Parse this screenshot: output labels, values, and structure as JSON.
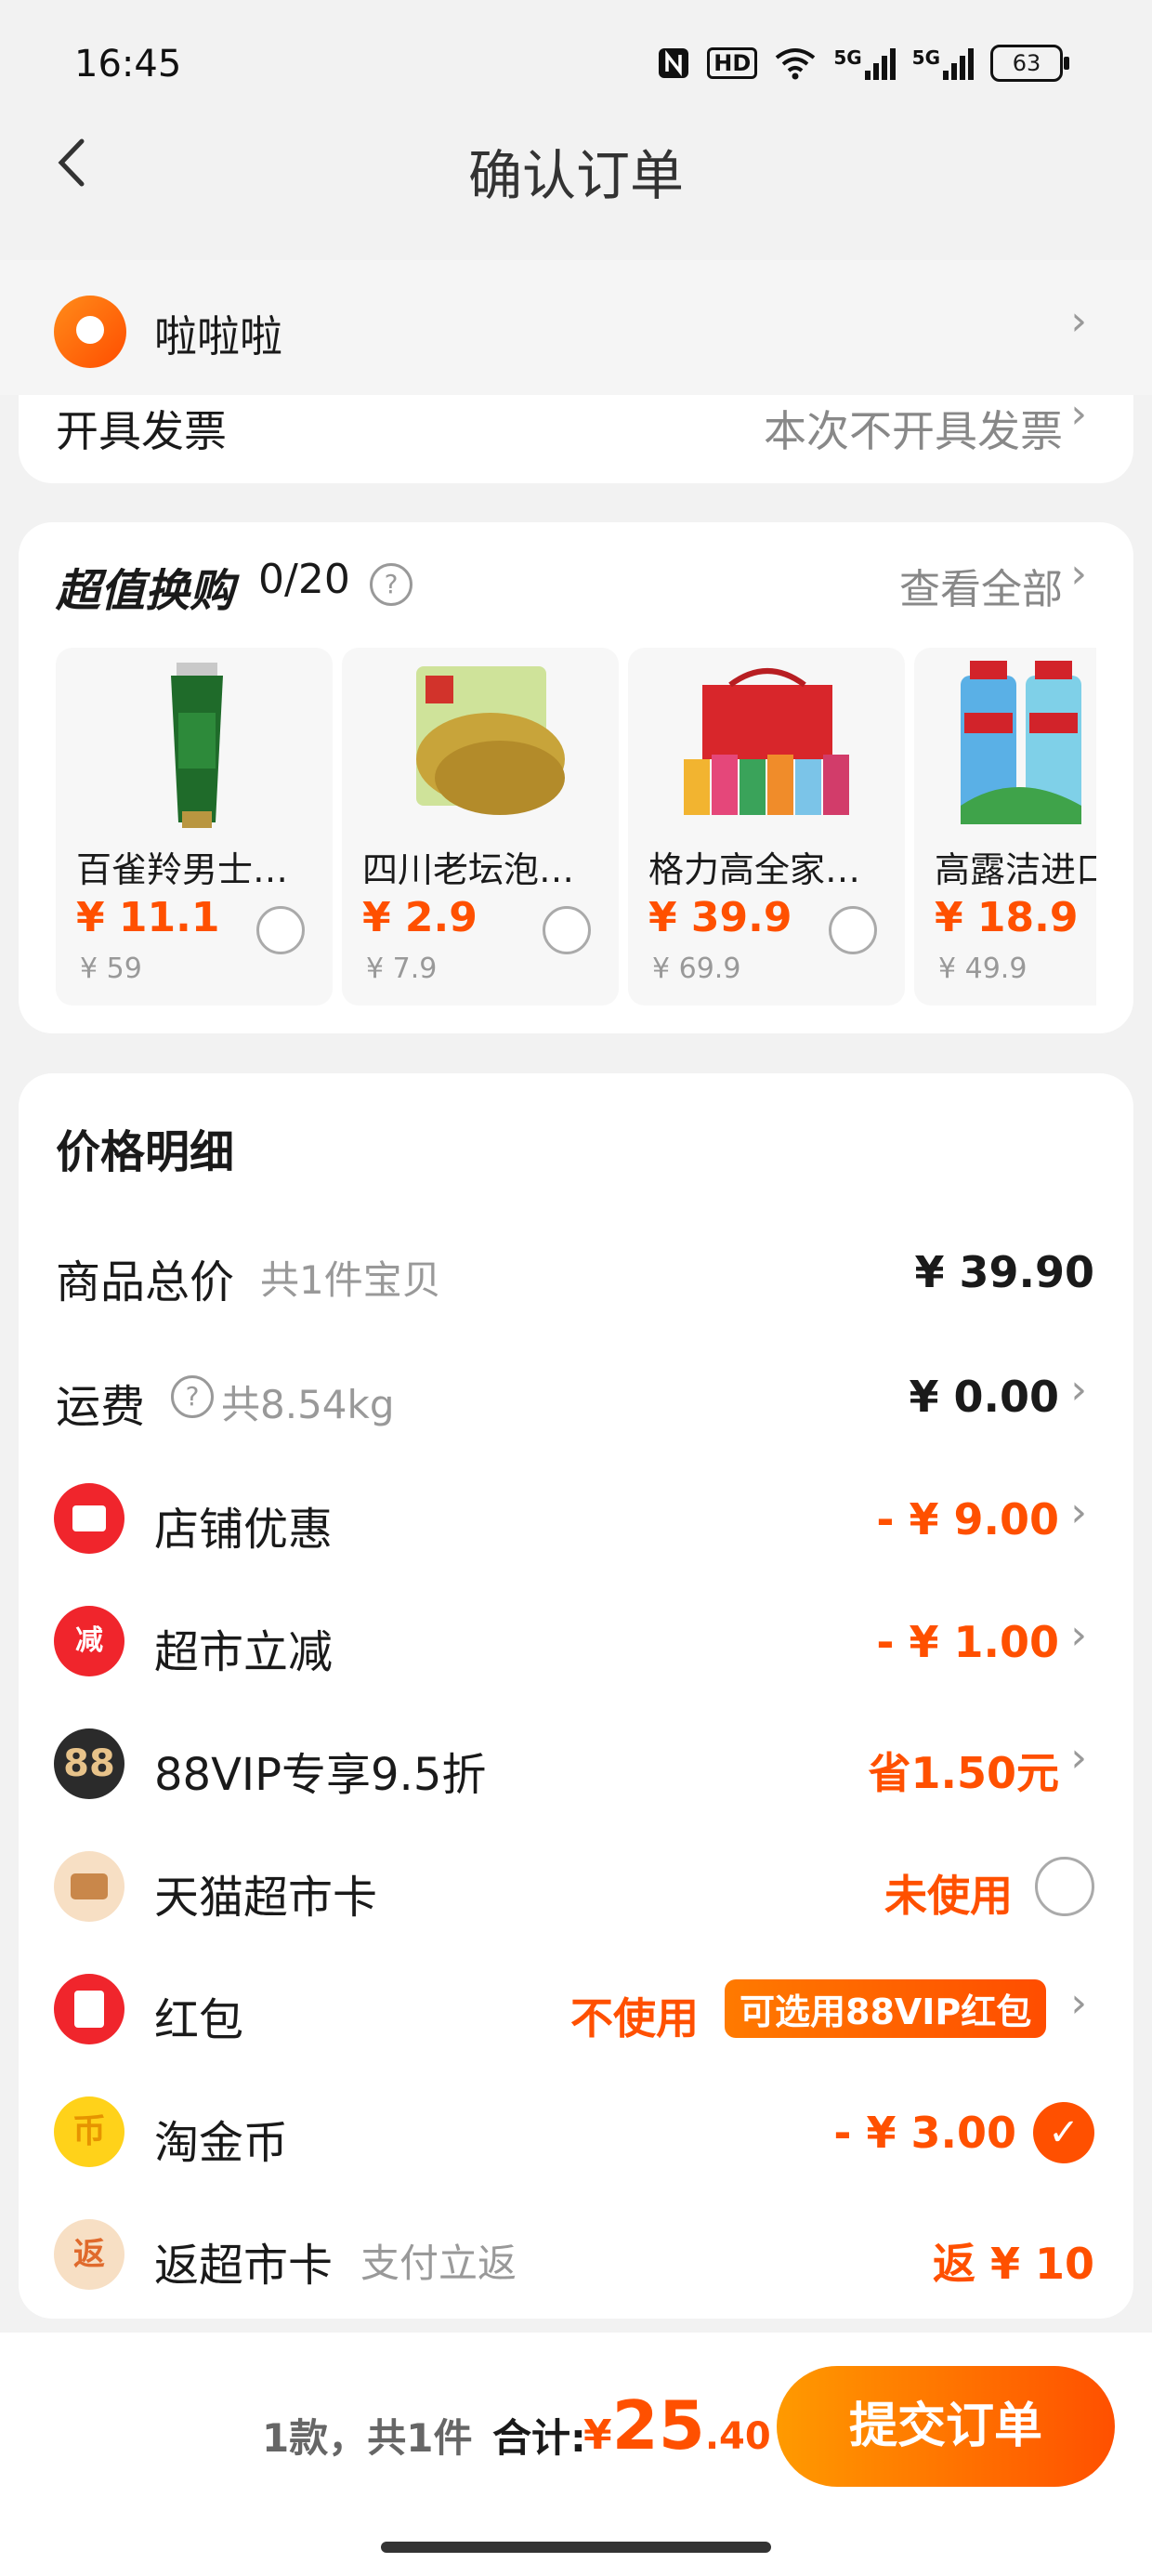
{
  "status_bar": {
    "time": "16:45",
    "battery": "63",
    "icons": [
      "nfc-icon",
      "hd-icon",
      "wifi-icon",
      "5g-signal-icon",
      "5g-signal-icon",
      "battery-icon"
    ],
    "hd": "HD",
    "g1": "5G",
    "g2": "5G"
  },
  "nav": {
    "title": "确认订单",
    "back_icon": "chevron-left-icon"
  },
  "address": {
    "name": "啦啦啦",
    "icon": "location-pin-icon"
  },
  "invoice": {
    "label": "开具发票",
    "value": "本次不开具发票"
  },
  "exchange": {
    "title": "超值换购",
    "count": "0/20",
    "view_all": "查看全部",
    "products": [
      {
        "name": "百雀羚男士洁面乳",
        "price": "¥ 11.1",
        "orig": "¥ 59",
        "image": "green-tube-icon"
      },
      {
        "name": "四川老坛泡酸菜",
        "price": "¥ 2.9",
        "orig": "¥ 7.9",
        "image": "pickled-vegetable-icon"
      },
      {
        "name": "格力高全家福礼盒",
        "price": "¥ 39.9",
        "orig": "¥ 69.9",
        "image": "gift-box-icon"
      },
      {
        "name": "高露洁进口漱口水",
        "price": "¥ 18.9",
        "orig": "¥ 49.9",
        "image": "mouthwash-icon"
      }
    ]
  },
  "price_detail": {
    "title": "价格明细",
    "goods_total": {
      "label": "商品总价",
      "sub": "共1件宝贝",
      "value": "¥ 39.90"
    },
    "shipping": {
      "label": "运费",
      "sub": "共8.54kg",
      "value": "¥ 0.00"
    },
    "shop_discount": {
      "label": "店铺优惠",
      "value": "- ¥ 9.00"
    },
    "market_cut": {
      "label": "超市立减",
      "value": "- ¥ 1.00",
      "icon_text": "减"
    },
    "vip": {
      "label": "88VIP专享9.5折",
      "value": "省1.50元",
      "icon_text": "88"
    },
    "market_card": {
      "label": "天猫超市卡",
      "value": "未使用"
    },
    "red_packet": {
      "label": "红包",
      "value": "不使用",
      "tag": "可选用88VIP红包"
    },
    "coin": {
      "label": "淘金币",
      "value": "- ¥ 3.00",
      "icon_text": "币"
    },
    "rebate": {
      "label": "返超市卡",
      "sub": "支付立返",
      "value": "返 ¥ 10",
      "icon_text": "返"
    }
  },
  "footer": {
    "count": "1款，共1件",
    "total_label": "合计:",
    "currency": "¥",
    "total_int": "25",
    "total_dec": ".40",
    "submit": "提交订单"
  },
  "colors": {
    "accent": "#ff5000",
    "background": "#f2f2f2"
  }
}
